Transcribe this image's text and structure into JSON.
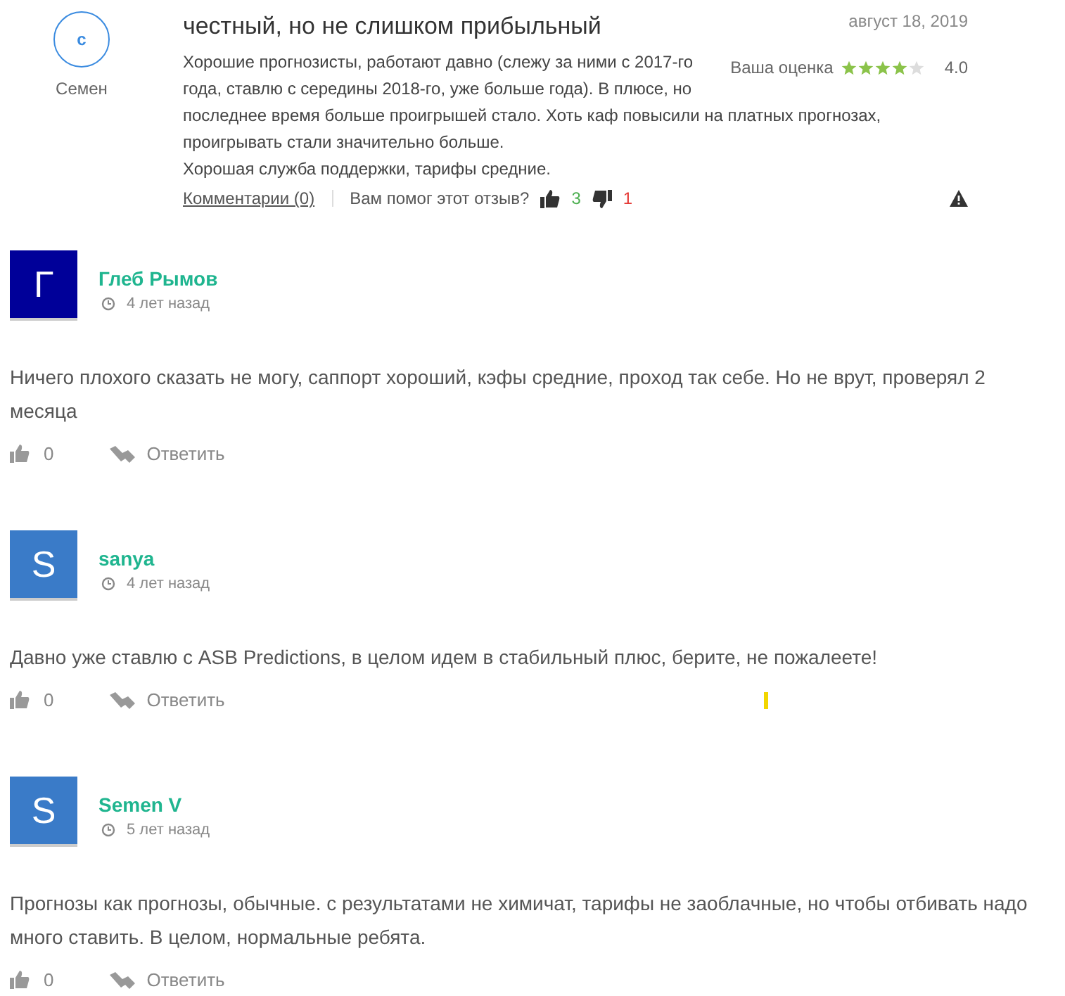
{
  "review": {
    "avatar_letter": "с",
    "author": "Семен",
    "title": "честный, но не слишком прибыльный",
    "date": "август 18, 2019",
    "rating_label": "Ваша оценка",
    "stars": 4,
    "rating": "4.0",
    "body": [
      "Хорошие прогнозисты, работают давно (слежу за ними с 2017-го года, ставлю с середины 2018-го, уже больше года). В плюсе, но",
      "последнее время больше проигрышей стало. Хоть каф повысили на платных прогнозах, проигрывать стали значительно больше.",
      "Хорошая служба поддержки, тарифы средние."
    ],
    "comments_link": "Комментарии (0)",
    "helpful_question": "Вам помог этот отзыв?",
    "likes": "3",
    "dislikes": "1"
  },
  "comments": [
    {
      "avatar_letter": "Г",
      "color": "#000099",
      "name": "Глеб Рымов",
      "time": "4 лет назад",
      "text": "Ничего плохого сказать не могу, саппорт хороший, кэфы средние, проход так себе. Но не врут, проверял 2 месяца",
      "likes": "0",
      "reply": "Ответить"
    },
    {
      "avatar_letter": "S",
      "color": "#3a7bc8",
      "name": "sanya",
      "time": "4 лет назад",
      "text": "Давно уже ставлю с ASB Predictions, в целом идем в стабильный плюс, берите, не пожалеете!",
      "likes": "0",
      "reply": "Ответить"
    },
    {
      "avatar_letter": "S",
      "color": "#3a7bc8",
      "name": "Semen V",
      "time": "5 лет назад",
      "text": "Прогнозы как прогнозы, обычные. с результатами не химичат, тарифы не заоблачные, но чтобы отбивать надо много ставить. В целом, нормальные ребята.",
      "likes": "0",
      "reply": "Ответить"
    }
  ]
}
